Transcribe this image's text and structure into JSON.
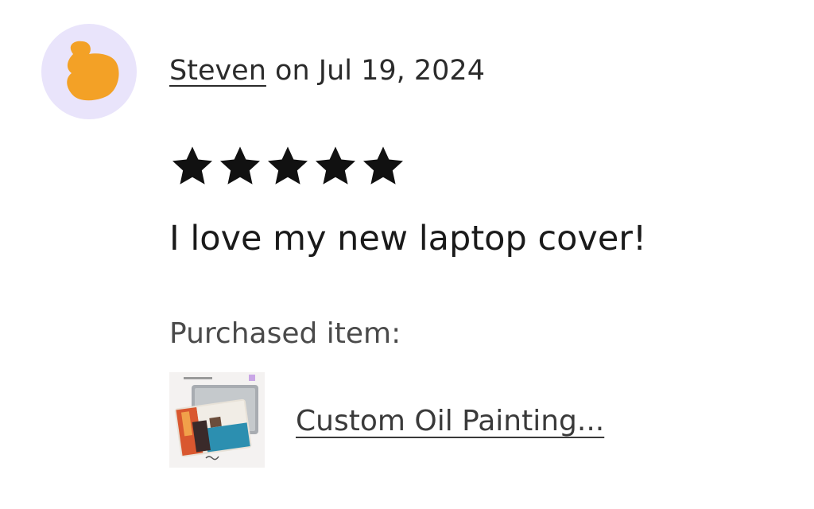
{
  "review": {
    "author": "Steven",
    "date_text": " on Jul 19, 2024",
    "rating": 5,
    "rating_max": 5,
    "text": "I love my new laptop cover!",
    "purchased_label": "Purchased item:",
    "item_title": "Custom Oil Painting..."
  },
  "icons": {
    "avatar": "blob-avatar-icon",
    "star": "star-filled-icon",
    "thumbnail": "laptop-cover-painting-thumbnail"
  },
  "colors": {
    "avatar_bg": "#e9e4fb",
    "avatar_blob": "#f3a126",
    "star": "#111111",
    "text": "#222222"
  }
}
